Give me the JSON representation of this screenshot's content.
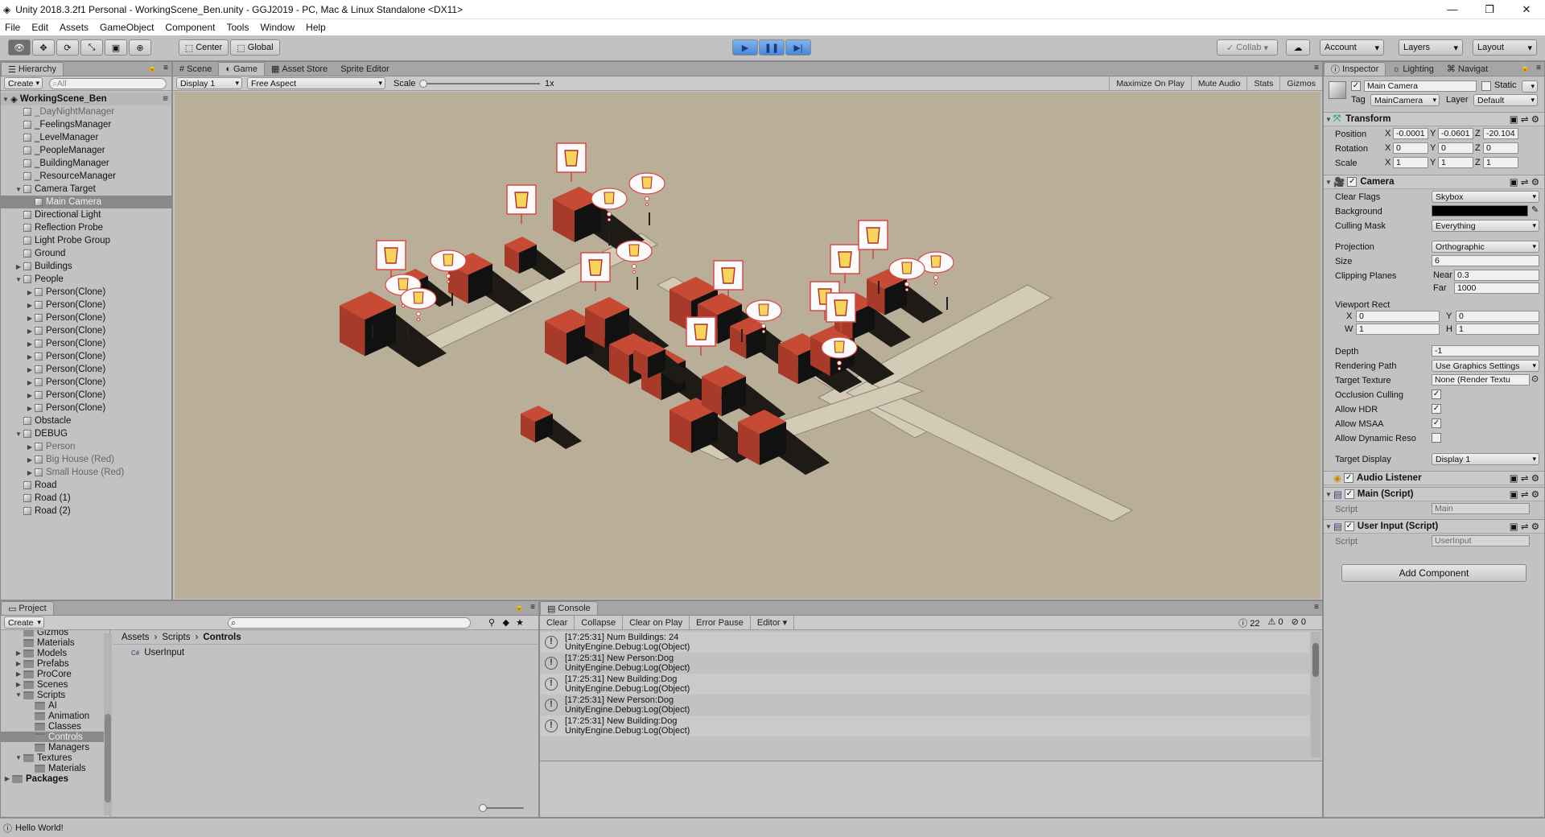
{
  "window": {
    "title": "Unity 2018.3.2f1 Personal - WorkingScene_Ben.unity - GGJ2019 - PC, Mac & Linux Standalone <DX11>",
    "min": "—",
    "max": "❐",
    "close": "✕"
  },
  "menu": [
    "File",
    "Edit",
    "Assets",
    "GameObject",
    "Component",
    "Tools",
    "Window",
    "Help"
  ],
  "toolbar": {
    "pivot": "Center",
    "space": "Global",
    "collab": "Collab",
    "account": "Account",
    "layers": "Layers",
    "layout": "Layout"
  },
  "hierarchy": {
    "tab": "Hierarchy",
    "create": "Create",
    "search_placeholder": "All",
    "scene": "WorkingScene_Ben",
    "items": [
      {
        "label": "_DayNightManager",
        "indent": 1,
        "dim": true
      },
      {
        "label": "_FeelingsManager",
        "indent": 1
      },
      {
        "label": "_LevelManager",
        "indent": 1
      },
      {
        "label": "_PeopleManager",
        "indent": 1
      },
      {
        "label": "_BuildingManager",
        "indent": 1
      },
      {
        "label": "_ResourceManager",
        "indent": 1
      },
      {
        "label": "Camera Target",
        "indent": 1,
        "arrow": "▼"
      },
      {
        "label": "Main Camera",
        "indent": 2,
        "selected": true
      },
      {
        "label": "Directional Light",
        "indent": 1
      },
      {
        "label": "Reflection Probe",
        "indent": 1
      },
      {
        "label": "Light Probe Group",
        "indent": 1
      },
      {
        "label": "Ground",
        "indent": 1
      },
      {
        "label": "Buildings",
        "indent": 1,
        "arrow": "▶"
      },
      {
        "label": "People",
        "indent": 1,
        "arrow": "▼"
      },
      {
        "label": "Person(Clone)",
        "indent": 2,
        "arrow": "▶"
      },
      {
        "label": "Person(Clone)",
        "indent": 2,
        "arrow": "▶"
      },
      {
        "label": "Person(Clone)",
        "indent": 2,
        "arrow": "▶"
      },
      {
        "label": "Person(Clone)",
        "indent": 2,
        "arrow": "▶"
      },
      {
        "label": "Person(Clone)",
        "indent": 2,
        "arrow": "▶"
      },
      {
        "label": "Person(Clone)",
        "indent": 2,
        "arrow": "▶"
      },
      {
        "label": "Person(Clone)",
        "indent": 2,
        "arrow": "▶"
      },
      {
        "label": "Person(Clone)",
        "indent": 2,
        "arrow": "▶"
      },
      {
        "label": "Person(Clone)",
        "indent": 2,
        "arrow": "▶"
      },
      {
        "label": "Person(Clone)",
        "indent": 2,
        "arrow": "▶"
      },
      {
        "label": "Obstacle",
        "indent": 1
      },
      {
        "label": "DEBUG",
        "indent": 1,
        "arrow": "▼"
      },
      {
        "label": "Person",
        "indent": 2,
        "arrow": "▶",
        "dim": true
      },
      {
        "label": "Big House (Red)",
        "indent": 2,
        "arrow": "▶",
        "dim": true
      },
      {
        "label": "Small House (Red)",
        "indent": 2,
        "arrow": "▶",
        "dim": true
      },
      {
        "label": "Road",
        "indent": 1
      },
      {
        "label": "Road (1)",
        "indent": 1
      },
      {
        "label": "Road (2)",
        "indent": 1
      }
    ]
  },
  "game": {
    "tabs": [
      "Scene",
      "Game",
      "Asset Store",
      "Sprite Editor"
    ],
    "display": "Display 1",
    "aspect": "Free Aspect",
    "scale_label": "Scale",
    "scale_value": "1x",
    "maximize": "Maximize On Play",
    "mute": "Mute Audio",
    "stats": "Stats",
    "gizmos": "Gizmos"
  },
  "inspector": {
    "tabs": [
      "Inspector",
      "Lighting",
      "Navigat"
    ],
    "object_name": "Main Camera",
    "static": "Static",
    "tag_label": "Tag",
    "tag": "MainCamera",
    "layer_label": "Layer",
    "layer": "Default",
    "transform": {
      "title": "Transform",
      "position_label": "Position",
      "rotation_label": "Rotation",
      "scale_label": "Scale",
      "position": {
        "x": "-0.0001",
        "y": "-0.0601",
        "z": "-20.104"
      },
      "rotation": {
        "x": "0",
        "y": "0",
        "z": "0"
      },
      "scale": {
        "x": "1",
        "y": "1",
        "z": "1"
      }
    },
    "camera": {
      "title": "Camera",
      "clear_flags_label": "Clear Flags",
      "clear_flags": "Skybox",
      "background_label": "Background",
      "culling_label": "Culling Mask",
      "culling": "Everything",
      "projection_label": "Projection",
      "projection": "Orthographic",
      "size_label": "Size",
      "size": "6",
      "clipping_label": "Clipping Planes",
      "near_label": "Near",
      "near": "0.3",
      "far_label": "Far",
      "far": "1000",
      "viewport_label": "Viewport Rect",
      "vx": "0",
      "vy": "0",
      "vw": "1",
      "vh": "1",
      "depth_label": "Depth",
      "depth": "-1",
      "rendering_label": "Rendering Path",
      "rendering": "Use Graphics Settings",
      "target_tex_label": "Target Texture",
      "target_tex": "None (Render Textu",
      "occlusion_label": "Occlusion Culling",
      "hdr_label": "Allow HDR",
      "msaa_label": "Allow MSAA",
      "dynres_label": "Allow Dynamic Reso",
      "target_display_label": "Target Display",
      "target_display": "Display 1"
    },
    "audio_listener": "Audio Listener",
    "main_script": {
      "title": "Main (Script)",
      "script_label": "Script",
      "script": "Main"
    },
    "user_input": {
      "title": "User Input (Script)",
      "script_label": "Script",
      "script": "UserInput"
    },
    "add_component": "Add Component",
    "background_color": "#000000"
  },
  "project": {
    "tab": "Project",
    "create": "Create",
    "tree": [
      {
        "label": "Gizmos",
        "indent": 1
      },
      {
        "label": "Materials",
        "indent": 1
      },
      {
        "label": "Models",
        "indent": 1,
        "arrow": "▶"
      },
      {
        "label": "Prefabs",
        "indent": 1,
        "arrow": "▶"
      },
      {
        "label": "ProCore",
        "indent": 1,
        "arrow": "▶"
      },
      {
        "label": "Scenes",
        "indent": 1,
        "arrow": "▶"
      },
      {
        "label": "Scripts",
        "indent": 1,
        "arrow": "▼"
      },
      {
        "label": "AI",
        "indent": 2
      },
      {
        "label": "Animation",
        "indent": 2
      },
      {
        "label": "Classes",
        "indent": 2
      },
      {
        "label": "Controls",
        "indent": 2,
        "selected": true
      },
      {
        "label": "Managers",
        "indent": 2
      },
      {
        "label": "Textures",
        "indent": 1,
        "arrow": "▼"
      },
      {
        "label": "Materials",
        "indent": 2
      },
      {
        "label": "Packages",
        "indent": 0,
        "arrow": "▶",
        "bold": true
      }
    ],
    "breadcrumb": [
      "Assets",
      "Scripts",
      "Controls"
    ],
    "files": [
      "UserInput"
    ]
  },
  "console": {
    "tab": "Console",
    "buttons": [
      "Clear",
      "Collapse",
      "Clear on Play",
      "Error Pause",
      "Editor"
    ],
    "count_log": "22",
    "count_warn": "0",
    "count_err": "0",
    "logs": [
      {
        "line1": "[17:25:31] Num Buildings: 24",
        "line2": "UnityEngine.Debug:Log(Object)"
      },
      {
        "line1": "[17:25:31] New Person:Dog",
        "line2": "UnityEngine.Debug:Log(Object)"
      },
      {
        "line1": "[17:25:31] New Building:Dog",
        "line2": "UnityEngine.Debug:Log(Object)"
      },
      {
        "line1": "[17:25:31] New Person:Dog",
        "line2": "UnityEngine.Debug:Log(Object)"
      },
      {
        "line1": "[17:25:31] New Building:Dog",
        "line2": "UnityEngine.Debug:Log(Object)"
      }
    ]
  },
  "status": "Hello World!",
  "colors": {
    "game_bg": "#b9ae98",
    "road": "#d3cbb6",
    "house_roof": "#c64a34",
    "house_front": "#a83a2a",
    "house_side": "#111111",
    "shadow": "#1e1a16",
    "play_blue": "#4a86d8"
  }
}
